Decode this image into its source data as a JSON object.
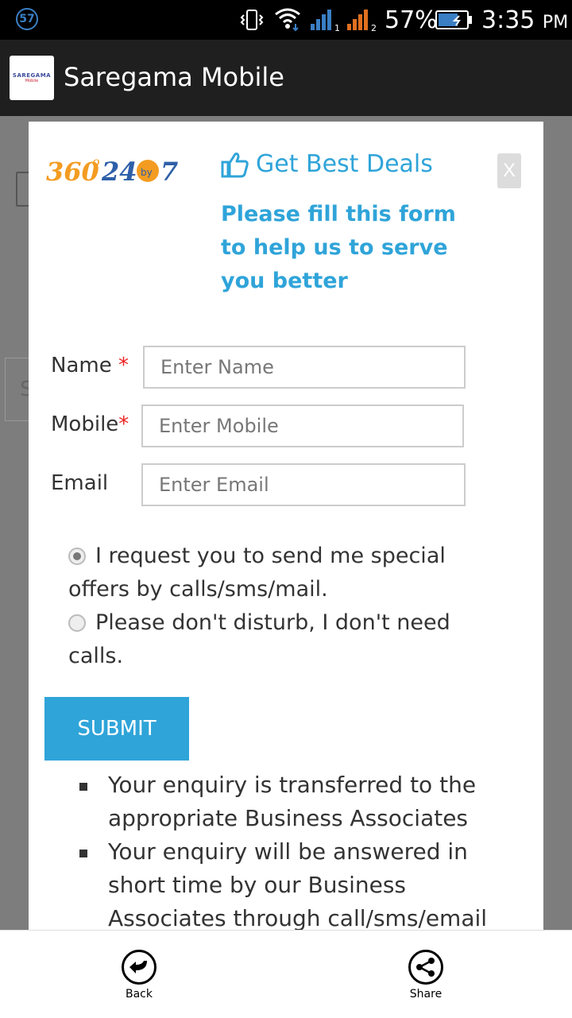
{
  "status_bar": {
    "notification_count": "57",
    "battery_percent": "57%",
    "time": "3:35",
    "time_suffix": "PM",
    "icons": [
      "vibrate-icon",
      "wifi-icon",
      "signal-sim1-icon",
      "signal-sim2-icon",
      "battery-charging-icon"
    ]
  },
  "app_bar": {
    "title": "Saregama Mobile",
    "logo_text": "SAREGAMA",
    "logo_sub": "Mobile"
  },
  "modal": {
    "brand_logo_text": "360°24by7",
    "deals_title": "Get Best Deals",
    "close_label": "X",
    "subtitle": "Please fill this form to help us to serve you better",
    "fields": {
      "name_label": "Name",
      "name_placeholder": "Enter Name",
      "mobile_label": "Mobile",
      "mobile_placeholder": "Enter Mobile",
      "email_label": "Email",
      "email_placeholder": "Enter Email",
      "required_mark": "*"
    },
    "options": [
      {
        "label": "I request you to send me special offers by calls/sms/mail.",
        "checked": true
      },
      {
        "label": "Please don't disturb, I don't need calls.",
        "checked": false
      }
    ],
    "submit_label": "SUBMIT",
    "bullets": [
      "Your enquiry is transferred to the appropriate Business Associates",
      "Your enquiry will be answered in short time by our Business Associates through call/sms/email"
    ]
  },
  "bottom_bar": {
    "back_label": "Back",
    "share_label": "Share"
  },
  "colors": {
    "accent": "#2fa4d9",
    "logo_orange": "#f39c21",
    "logo_blue": "#2d5fa8",
    "required": "#e22222"
  }
}
